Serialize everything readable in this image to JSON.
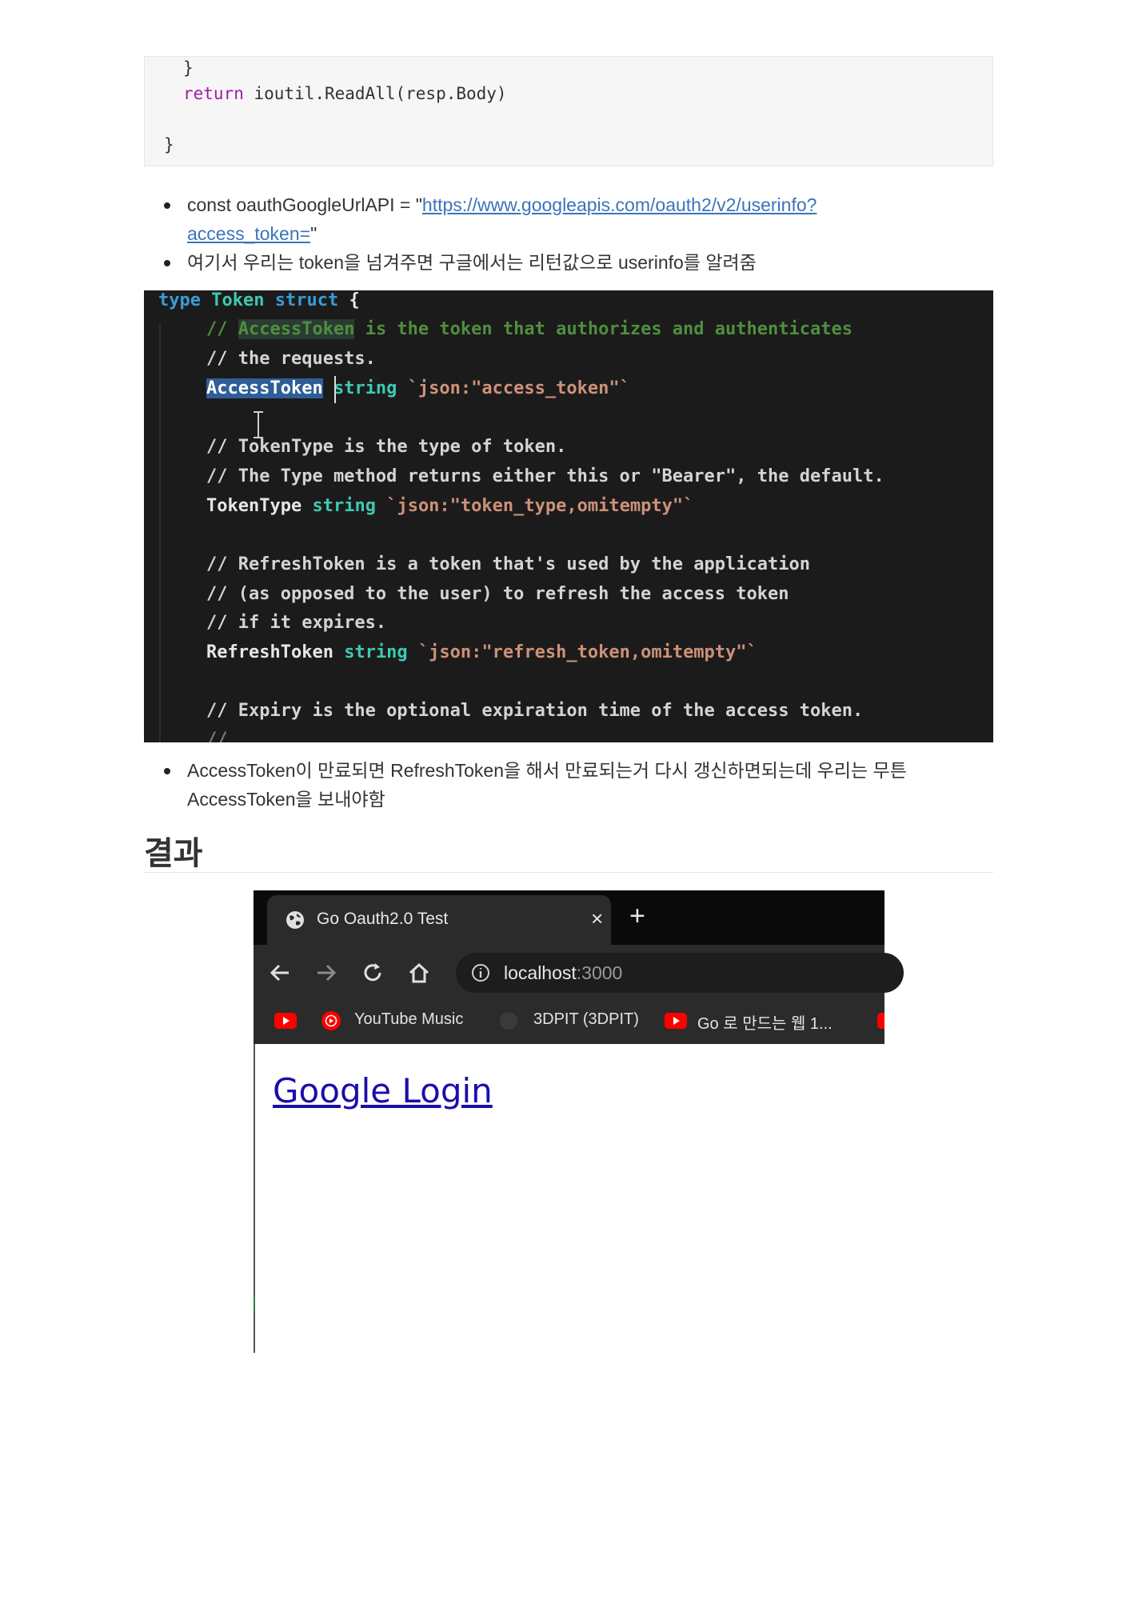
{
  "top_code": {
    "line1": "}",
    "line2_keyword": "return",
    "line2_rest": " ioutil.ReadAll(resp.Body)",
    "line3": "}"
  },
  "bullets1": {
    "item1_prefix": "const oauthGoogleUrlAPI = \"",
    "item1_link_part1": "https://www.googleapis.com/oauth2/v2/userinfo?",
    "item1_link_part2": "access_token=",
    "item1_suffix": "\"",
    "item2": "여기서 우리는 token을 넘겨주면 구글에서는 리턴값으로 userinfo를 알려줌"
  },
  "dark_code": {
    "l1_kw1": "type",
    "l1_type": "Token",
    "l1_kw2": "struct",
    "l1_brace": " {",
    "l2_pre": "// ",
    "l2_hl": "AccessToken",
    "l2_post": " is the token that authorizes and authenticates",
    "l3": "// the requests.",
    "l4_sel": "AccessToken",
    "l4_type": "string",
    "l4_tag": "`json:\"access_token\"`",
    "l5": "// TokenType is the type of token.",
    "l6": "// The Type method returns either this or \"Bearer\", the default.",
    "l7_field": "TokenType",
    "l7_type": "string",
    "l7_tag": "`json:\"token_type,omitempty\"`",
    "l8": "// RefreshToken is a token that's used by the application",
    "l9": "// (as opposed to the user) to refresh the access token",
    "l10": "// if it expires.",
    "l11_field": "RefreshToken",
    "l11_type": "string",
    "l11_tag": "`json:\"refresh_token,omitempty\"`",
    "l12": "// Expiry is the optional expiration time of the access token.",
    "l13": "//"
  },
  "bullets2": {
    "item1_line1": "AccessToken이 만료되면 RefreshToken을 해서 만료되는거 다시 갱신하면되는데 우리는 무튼",
    "item1_line2": "AccessToken을 보내야함"
  },
  "heading": "결과",
  "browser": {
    "tab_title": "Go Oauth2.0 Test",
    "tab_close": "×",
    "new_tab": "+",
    "url_host": "localhost",
    "url_port": ":3000",
    "bookmarks": [
      "YouTube Music",
      "3DPIT (3DPIT)",
      "Go 로 만드는 웹 1..."
    ],
    "link_text": "Google Login"
  },
  "colors": {
    "link_blue": "#3b73b9",
    "youtube_red": "#ff0000",
    "visited_link": "#1a0dab"
  },
  "icons": [
    "globe-icon",
    "back-arrow-icon",
    "forward-arrow-icon",
    "reload-icon",
    "home-icon",
    "info-icon",
    "youtube-icon",
    "youtube-music-icon",
    "github-icon"
  ]
}
